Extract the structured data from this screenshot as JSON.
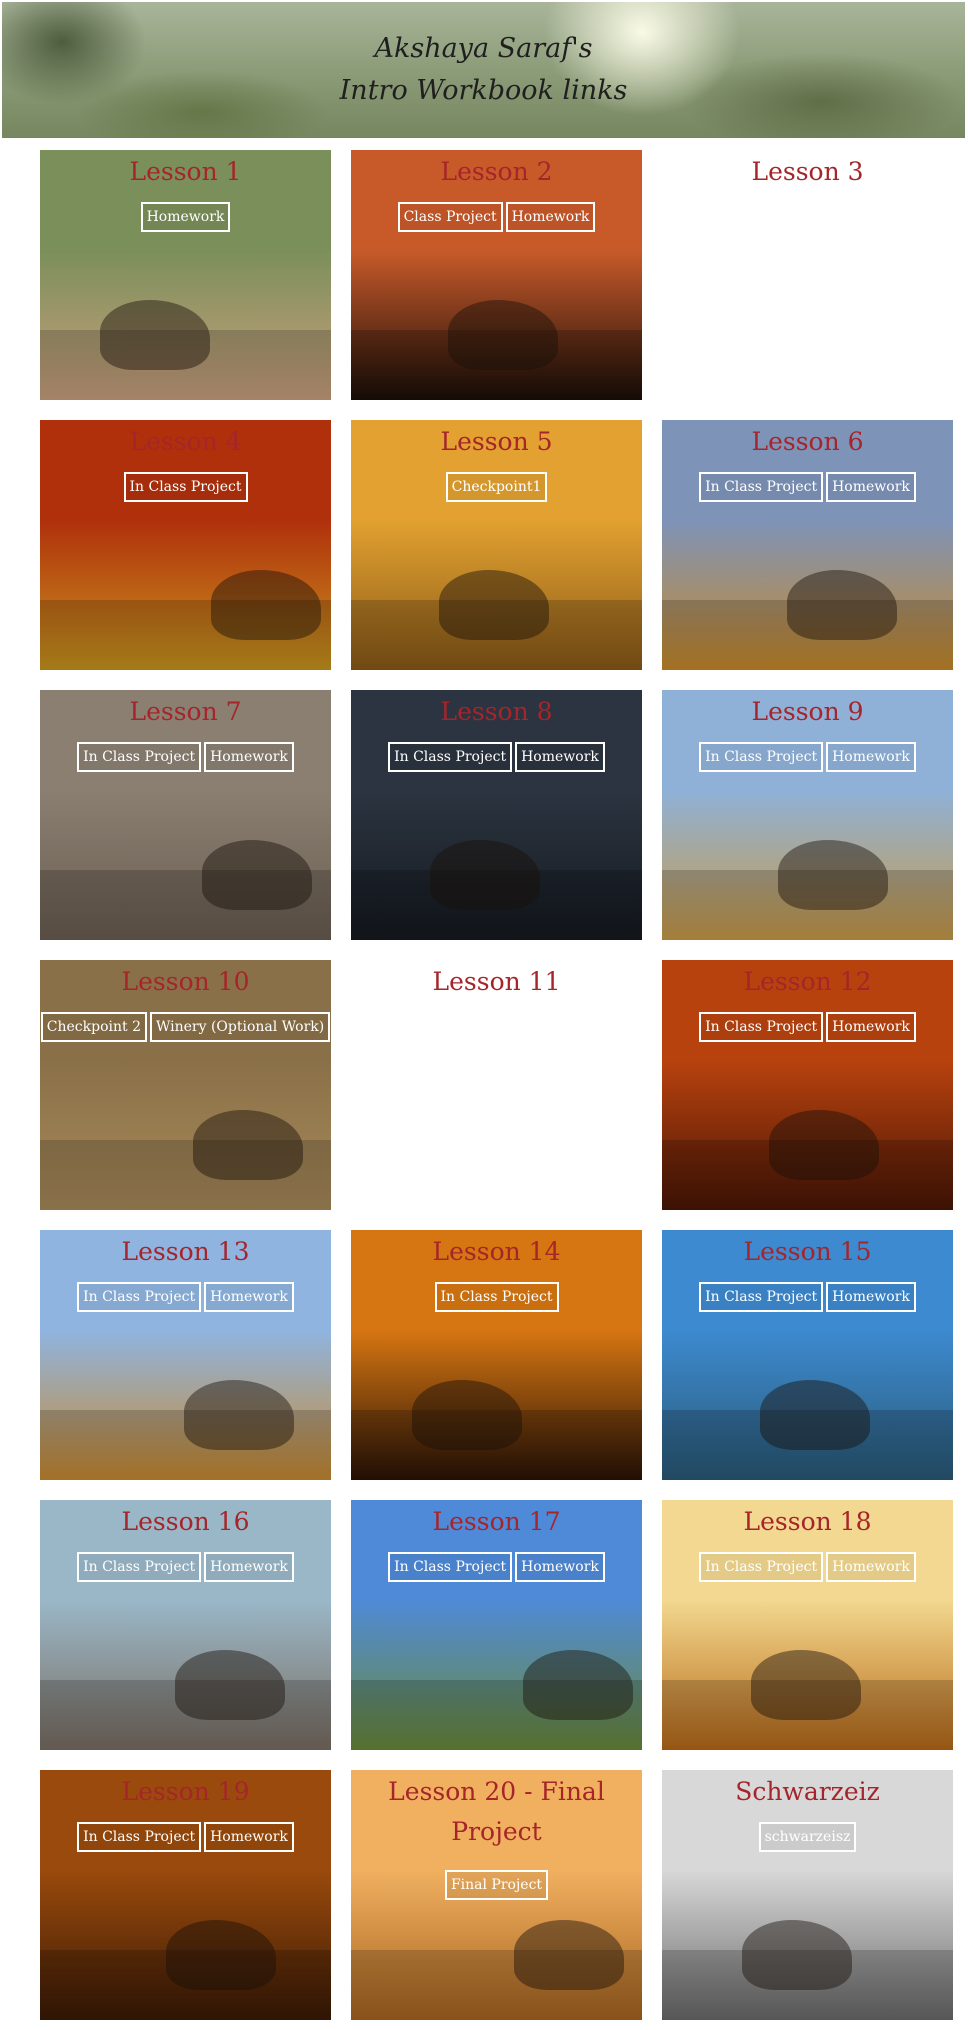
{
  "header": {
    "line1": "Akshaya Saraf's",
    "line2": "Intro Workbook links"
  },
  "tiles": [
    {
      "title": "Lesson 1",
      "buttons": [
        "Homework"
      ],
      "bg": "#7b8f5a",
      "bg2": "#c9a07e"
    },
    {
      "title": "Lesson 2",
      "buttons": [
        "Class Project",
        "Homework"
      ],
      "bg": "#c85a2a",
      "bg2": "#1a0e08"
    },
    {
      "title": "Lesson 3",
      "buttons": [],
      "bg": "#ffffff",
      "bg2": "#ffffff"
    },
    {
      "title": "Lesson 4",
      "buttons": [
        "In Class Project"
      ],
      "bg": "#b0300c",
      "bg2": "#c9961f"
    },
    {
      "title": "Lesson 5",
      "buttons": [
        "Checkpoint1"
      ],
      "bg": "#e2a130",
      "bg2": "#8a5a18"
    },
    {
      "title": "Lesson 6",
      "buttons": [
        "In Class Project",
        "Homework"
      ],
      "bg": "#7e93b8",
      "bg2": "#c88a2a"
    },
    {
      "title": "Lesson 7",
      "buttons": [
        "In Class Project",
        "Homework"
      ],
      "bg": "#8b7f72",
      "bg2": "#6a5e52"
    },
    {
      "title": "Lesson 8",
      "buttons": [
        "In Class Project",
        "Homework"
      ],
      "bg": "#2b3440",
      "bg2": "#151a20"
    },
    {
      "title": "Lesson 9",
      "buttons": [
        "In Class Project",
        "Homework"
      ],
      "bg": "#8fb1d8",
      "bg2": "#c89a48"
    },
    {
      "title": "Lesson 10",
      "buttons": [
        "Checkpoint 2",
        "Winery (Optional Work)"
      ],
      "bg": "#8a7048",
      "bg2": "#a88a5a"
    },
    {
      "title": "Lesson 11",
      "buttons": [],
      "bg": "#ffffff",
      "bg2": "#ffffff"
    },
    {
      "title": "Lesson 12",
      "buttons": [
        "In Class Project",
        "Homework"
      ],
      "bg": "#b8420e",
      "bg2": "#4a1606"
    },
    {
      "title": "Lesson 13",
      "buttons": [
        "In Class Project",
        "Homework"
      ],
      "bg": "#8fb4e0",
      "bg2": "#c88a30"
    },
    {
      "title": "Lesson 14",
      "buttons": [
        "In Class Project"
      ],
      "bg": "#d67612",
      "bg2": "#2a1306"
    },
    {
      "title": "Lesson 15",
      "buttons": [
        "In Class Project",
        "Homework"
      ],
      "bg": "#3d8ad0",
      "bg2": "#2a5a78"
    },
    {
      "title": "Lesson 16",
      "buttons": [
        "In Class Project",
        "Homework"
      ],
      "bg": "#9ab7c8",
      "bg2": "#7a6e62"
    },
    {
      "title": "Lesson 17",
      "buttons": [
        "In Class Project",
        "Homework"
      ],
      "bg": "#4f8ad8",
      "bg2": "#6a8a3a"
    },
    {
      "title": "Lesson 18",
      "buttons": [
        "In Class Project",
        "Homework"
      ],
      "bg": "#f2d890",
      "bg2": "#b86a18"
    },
    {
      "title": "Lesson 19",
      "buttons": [
        "In Class Project",
        "Homework"
      ],
      "bg": "#9a4a0c",
      "bg2": "#3a1a06"
    },
    {
      "title": "Lesson 20 - Final Project",
      "buttons": [
        "Final Project"
      ],
      "bg": "#f0b060",
      "bg2": "#a86420"
    },
    {
      "title": "Schwarzeiz",
      "buttons": [
        "schwarzeisz"
      ],
      "bg": "#d8d8d8",
      "bg2": "#6a6a6a"
    }
  ]
}
